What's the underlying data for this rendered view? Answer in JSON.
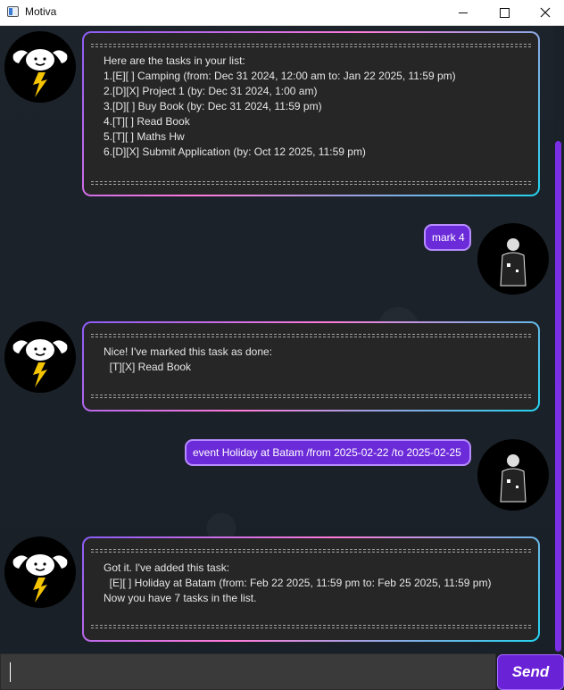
{
  "window": {
    "title": "Motiva",
    "controls": {
      "minimize_icon": "minimize-icon",
      "maximize_icon": "maximize-icon",
      "close_icon": "close-icon"
    }
  },
  "messages": [
    {
      "sender": "bot",
      "separator": "========================================================================",
      "lines": [
        "Here are the tasks in your list:",
        "1.[E][ ] Camping (from: Dec 31 2024, 12:00 am to: Jan 22 2025, 11:59 pm)",
        "2.[D][X] Project 1 (by: Dec 31 2024, 1:00 am)",
        "3.[D][ ] Buy Book (by: Dec 31 2024, 11:59 pm)",
        "4.[T][ ] Read Book",
        "5.[T][ ] Maths Hw",
        "6.[D][X] Submit Application (by: Oct 12 2025, 11:59 pm)"
      ]
    },
    {
      "sender": "user",
      "text": "mark 4"
    },
    {
      "sender": "bot",
      "separator": "========================================================================",
      "lines": [
        "Nice! I've marked this task as done:",
        "  [T][X] Read Book"
      ]
    },
    {
      "sender": "user",
      "text": "event Holiday at Batam /from 2025-02-22 /to 2025-02-25"
    },
    {
      "sender": "bot",
      "separator": "========================================================================",
      "lines": [
        "Got it. I've added this task:",
        "  [E][ ] Holiday at Batam (from: Feb 22 2025, 11:59 pm to: Feb 25 2025, 11:59 pm)",
        "Now you have 7 tasks in the list."
      ]
    }
  ],
  "input": {
    "value": "",
    "placeholder": ""
  },
  "send_button": {
    "label": "Send"
  },
  "colors": {
    "accent": "#6a22d6",
    "bubble_border_start": "#8a5cf6",
    "bubble_border_end": "#22d3ee",
    "bot_bubble_bg": "#262626"
  }
}
